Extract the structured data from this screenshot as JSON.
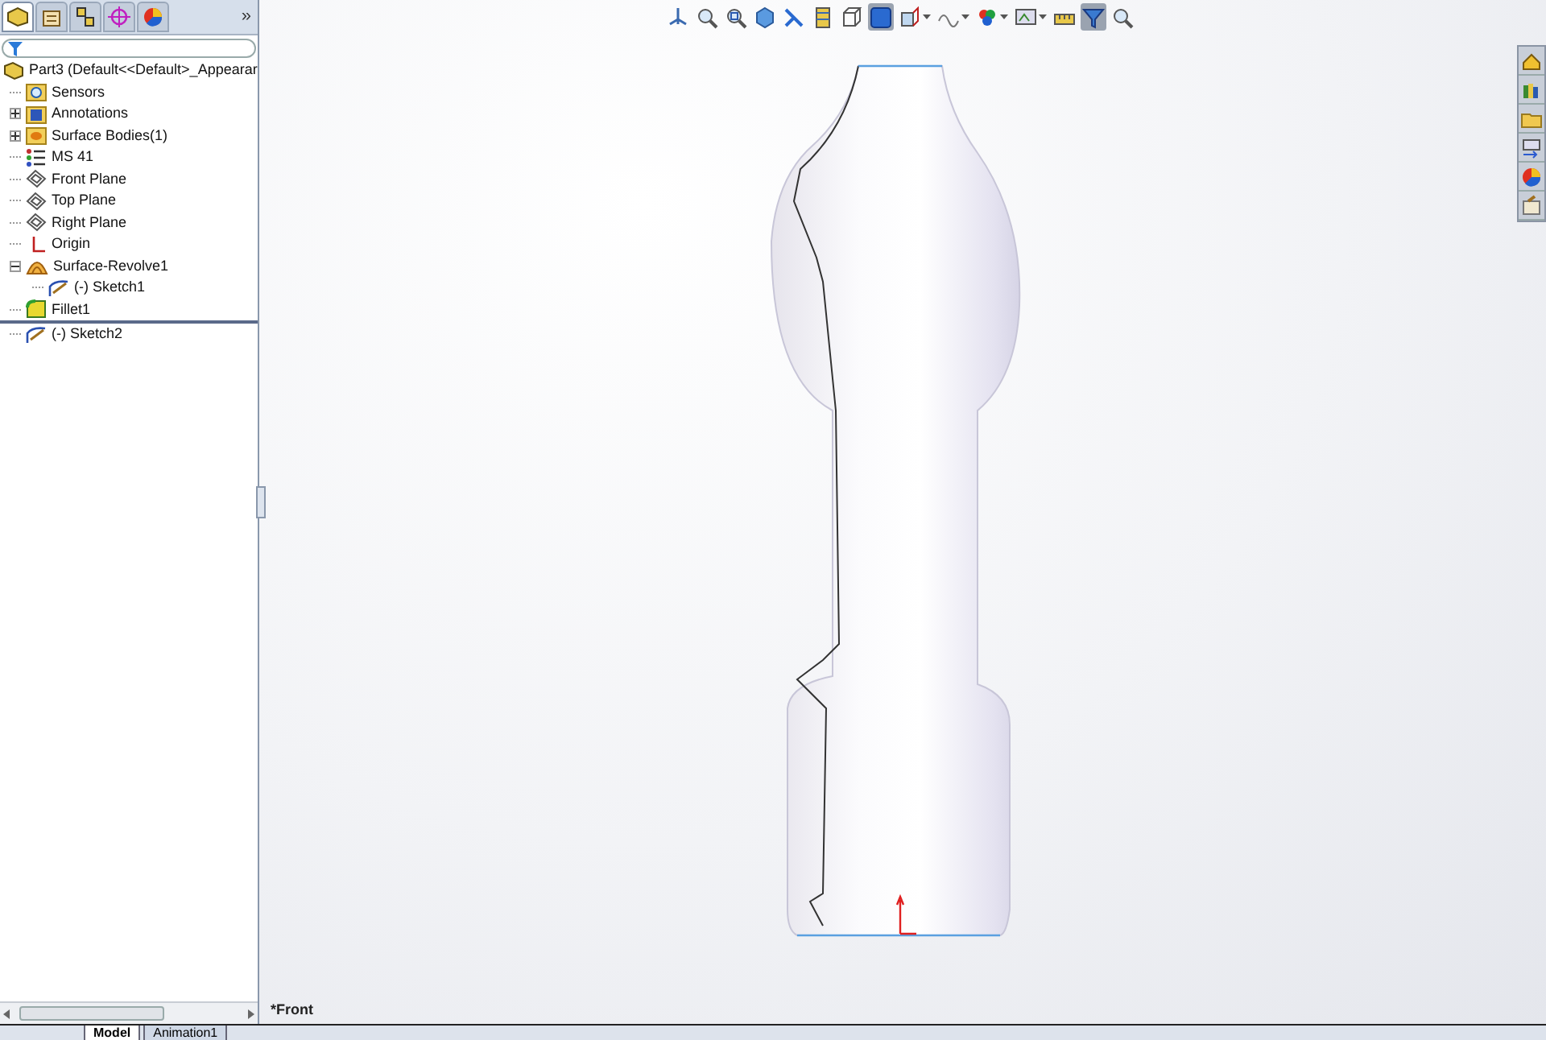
{
  "panel_tabs": [
    {
      "selected": true
    },
    {
      "selected": false
    },
    {
      "selected": false
    },
    {
      "selected": false
    },
    {
      "selected": false
    }
  ],
  "panel_more": "»",
  "tree": {
    "label": "Part3  (Default<<Default>_Appearar",
    "kind": "part",
    "children": [
      {
        "label": "Sensors",
        "kind": "sensor"
      },
      {
        "label": "Annotations",
        "kind": "annotation",
        "expanded": false
      },
      {
        "label": "Surface Bodies(1)",
        "kind": "bodies",
        "expanded": false
      },
      {
        "label": "MS 41",
        "kind": "material"
      },
      {
        "label": "Front Plane",
        "kind": "plane"
      },
      {
        "label": "Top Plane",
        "kind": "plane"
      },
      {
        "label": "Right Plane",
        "kind": "plane"
      },
      {
        "label": "Origin",
        "kind": "origin"
      },
      {
        "label": "Surface-Revolve1",
        "kind": "revolve",
        "expanded": true,
        "children": [
          {
            "label": "(-) Sketch1",
            "kind": "sketch"
          }
        ]
      },
      {
        "label": "Fillet1",
        "kind": "fillet"
      },
      {
        "label": "(-) Sketch2",
        "kind": "sketch",
        "rolled_back": true
      }
    ]
  },
  "view_label": "*Front",
  "bottom_tabs": [
    {
      "label": "Model",
      "selected": true
    },
    {
      "label": "Animation1",
      "selected": false
    }
  ]
}
